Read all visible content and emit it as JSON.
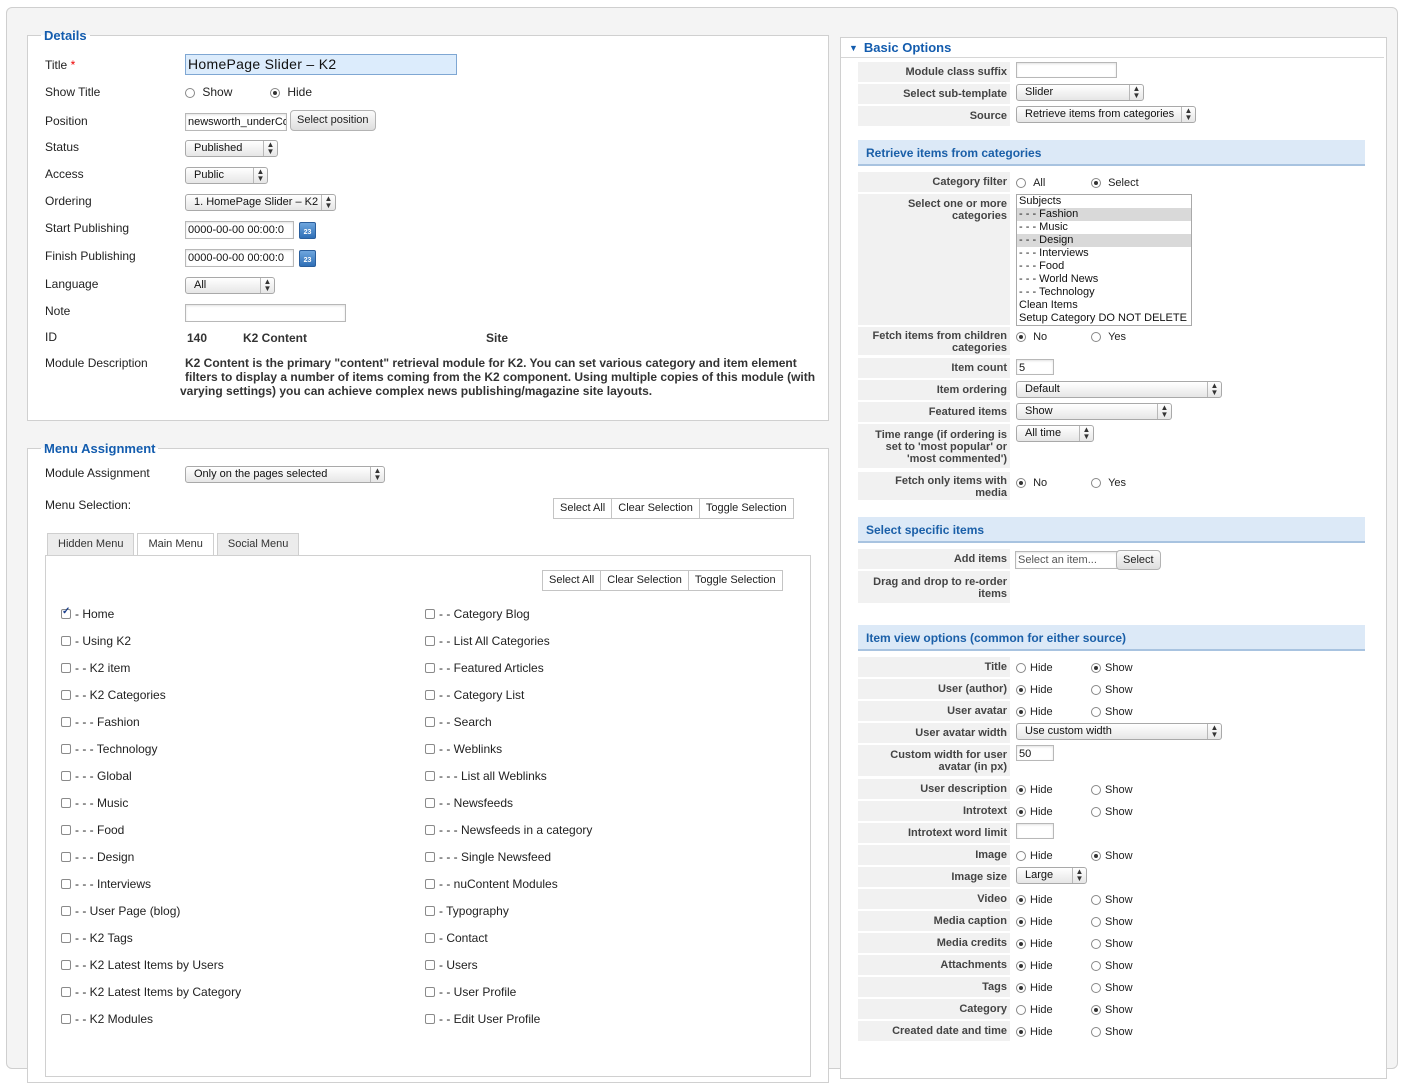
{
  "details": {
    "legend": "Details",
    "title_label": "Title",
    "required_mark": "*",
    "title_value": "HomePage Slider – K2",
    "show_title_label": "Show Title",
    "show_label": "Show",
    "hide_label": "Hide",
    "show_title_selected": "Hide",
    "position_label": "Position",
    "position_value": "newsworth_underCo",
    "select_position_button": "Select position",
    "status_label": "Status",
    "status_value": "Published",
    "access_label": "Access",
    "access_value": "Public",
    "ordering_label": "Ordering",
    "ordering_value": "1. HomePage Slider – K2",
    "start_publishing_label": "Start Publishing",
    "start_publishing_value": "0000-00-00 00:00:0",
    "finish_publishing_label": "Finish Publishing",
    "finish_publishing_value": "0000-00-00 00:00:0",
    "calendar_text": "23",
    "language_label": "Language",
    "language_value": "All",
    "note_label": "Note",
    "note_value": "",
    "id_label": "ID",
    "id_value": "140",
    "module_type": "K2 Content",
    "client": "Site",
    "description_label": "Module Description",
    "description_line1": "K2 Content is the primary \"content\" retrieval module for K2. You can set various category and item element",
    "description_line2": "filters to display a number of items coming from the K2 component. Using multiple copies of this module (with",
    "description_line3": "varying settings) you can achieve complex news publishing/magazine site layouts."
  },
  "menu_assignment": {
    "legend": "Menu Assignment",
    "module_assignment_label": "Module Assignment",
    "module_assignment_value": "Only on the pages selected",
    "menu_selection_label": "Menu Selection:",
    "select_all": "Select All",
    "clear_selection": "Clear Selection",
    "toggle_selection": "Toggle Selection",
    "tabs": [
      "Hidden Menu",
      "Main Menu",
      "Social Menu"
    ],
    "active_tab": "Main Menu",
    "left_items": [
      {
        "label": "- Home",
        "checked": true
      },
      {
        "label": "- Using K2",
        "checked": false
      },
      {
        "label": "- - K2 item",
        "checked": false
      },
      {
        "label": "- - K2 Categories",
        "checked": false
      },
      {
        "label": "- - - Fashion",
        "checked": false
      },
      {
        "label": "- - - Technology",
        "checked": false
      },
      {
        "label": "- - - Global",
        "checked": false
      },
      {
        "label": "- - - Music",
        "checked": false
      },
      {
        "label": "- - - Food",
        "checked": false
      },
      {
        "label": "- - - Design",
        "checked": false
      },
      {
        "label": "- - - Interviews",
        "checked": false
      },
      {
        "label": "- - User Page (blog)",
        "checked": false
      },
      {
        "label": "- - K2 Tags",
        "checked": false
      },
      {
        "label": "- - K2 Latest Items by Users",
        "checked": false
      },
      {
        "label": "- - K2 Latest Items by Category",
        "checked": false
      },
      {
        "label": "- - K2 Modules",
        "checked": false
      }
    ],
    "right_items": [
      {
        "label": "- - Category Blog",
        "checked": false
      },
      {
        "label": "- - List All Categories",
        "checked": false
      },
      {
        "label": "- - Featured Articles",
        "checked": false
      },
      {
        "label": "- - Category List",
        "checked": false
      },
      {
        "label": "- - Search",
        "checked": false
      },
      {
        "label": "- - Weblinks",
        "checked": false
      },
      {
        "label": "- - - List all Weblinks",
        "checked": false
      },
      {
        "label": "- - Newsfeeds",
        "checked": false
      },
      {
        "label": "- - - Newsfeeds in a category",
        "checked": false
      },
      {
        "label": "- - - Single Newsfeed",
        "checked": false
      },
      {
        "label": "- - nuContent Modules",
        "checked": false
      },
      {
        "label": "- Typography",
        "checked": false
      },
      {
        "label": "- Contact",
        "checked": false
      },
      {
        "label": "- Users",
        "checked": false
      },
      {
        "label": "- - User Profile",
        "checked": false
      },
      {
        "label": "- - Edit User Profile",
        "checked": false
      }
    ]
  },
  "basic_options": {
    "title": "Basic Options",
    "module_class_suffix_label": "Module class suffix",
    "module_class_suffix_value": "",
    "sub_template_label": "Select sub-template",
    "sub_template_value": "Slider",
    "source_label": "Source",
    "source_value": "Retrieve items from categories",
    "retrieve_section": "Retrieve items from categories",
    "category_filter_label": "Category filter",
    "all_label": "All",
    "select_label": "Select",
    "select_categories_label_1": "Select one or more",
    "select_categories_label_2": "categories",
    "categories": [
      {
        "label": "Subjects",
        "selected": false
      },
      {
        "label": "- - - Fashion",
        "selected": true
      },
      {
        "label": "- - - Music",
        "selected": false
      },
      {
        "label": "- - - Design",
        "selected": true
      },
      {
        "label": "- - - Interviews",
        "selected": false
      },
      {
        "label": "- - - Food",
        "selected": false
      },
      {
        "label": "- - - World News",
        "selected": false
      },
      {
        "label": "- - - Technology",
        "selected": false
      },
      {
        "label": "Clean Items",
        "selected": false
      },
      {
        "label": "Setup Category DO NOT DELETE",
        "selected": false
      }
    ],
    "fetch_children_label_1": "Fetch items from children",
    "fetch_children_label_2": "categories",
    "no_label": "No",
    "yes_label": "Yes",
    "item_count_label": "Item count",
    "item_count_value": "5",
    "item_ordering_label": "Item ordering",
    "item_ordering_value": "Default",
    "featured_items_label": "Featured items",
    "featured_items_value": "Show",
    "time_range_label_1": "Time range (if ordering is",
    "time_range_label_2": "set to 'most popular' or",
    "time_range_label_3": "'most commented')",
    "time_range_value": "All time",
    "fetch_media_label_1": "Fetch only items with",
    "fetch_media_label_2": "media",
    "specific_section": "Select specific items",
    "add_items_label": "Add items",
    "add_items_placeholder": "Select an item...",
    "add_items_button": "Select",
    "drag_drop_label_1": "Drag and drop to re-order",
    "drag_drop_label_2": "items",
    "item_view_section": "Item view options (common for either source)",
    "hide_label": "Hide",
    "show_label": "Show",
    "title_label": "Title",
    "user_author_label": "User (author)",
    "user_avatar_label": "User avatar",
    "user_avatar_width_label": "User avatar width",
    "user_avatar_width_value": "Use custom width",
    "custom_width_label_1": "Custom width for user",
    "custom_width_label_2": "avatar (in px)",
    "custom_width_value": "50",
    "user_description_label": "User description",
    "introtext_label": "Introtext",
    "introtext_limit_label": "Introtext word limit",
    "introtext_limit_value": "",
    "image_label": "Image",
    "image_size_label": "Image size",
    "image_size_value": "Large",
    "video_label": "Video",
    "media_caption_label": "Media caption",
    "media_credits_label": "Media credits",
    "attachments_label": "Attachments",
    "tags_label": "Tags",
    "category_label": "Category",
    "created_date_label": "Created date and time"
  }
}
